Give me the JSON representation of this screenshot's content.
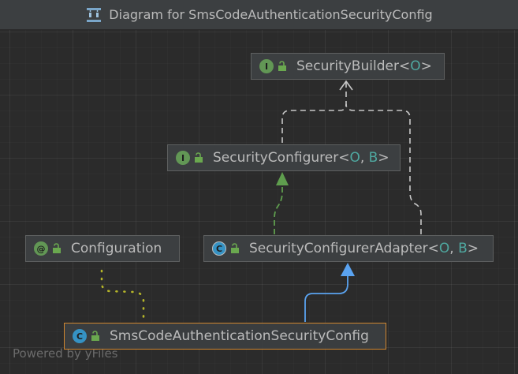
{
  "window": {
    "title": "Diagram for SmsCodeAuthenticationSecurityConfig"
  },
  "nodes": {
    "security_builder": {
      "kind": "interface",
      "badge": "I",
      "name": "SecurityBuilder",
      "lt": "<",
      "params": "O",
      "gt": ">"
    },
    "security_configurer": {
      "kind": "interface",
      "badge": "I",
      "name": "SecurityConfigurer",
      "lt": "<",
      "param1": "O",
      "sep": ", ",
      "param2": "B",
      "gt": ">"
    },
    "configuration": {
      "kind": "annotation",
      "badge": "@",
      "name": "Configuration"
    },
    "security_configurer_adapter": {
      "kind": "abstract-class",
      "badge": "C",
      "name": "SecurityConfigurerAdapter",
      "lt": "<",
      "param1": "O",
      "sep": ", ",
      "param2": "B",
      "gt": ">"
    },
    "sms_config": {
      "kind": "class",
      "badge": "C",
      "name": "SmsCodeAuthenticationSecurityConfig",
      "selected": true
    }
  },
  "watermark": "Powered by yFiles",
  "colors": {
    "background": "#2b2b2b",
    "node_fill": "#3c3f41",
    "node_border": "#5e6060",
    "selected_border": "#d0862f",
    "text": "#bbbbbb",
    "type_param": "#4fa8a0",
    "interface_green": "#629755",
    "class_blue": "#3592c4",
    "implements_edge": "#5f9e4e",
    "extends_edge": "#5aa3f0",
    "annotation_edge": "#b5b52a",
    "dashed_gray": "#c8c8c8"
  },
  "icons": {
    "title": "diagram-icon",
    "lock": "unlocked-icon"
  }
}
